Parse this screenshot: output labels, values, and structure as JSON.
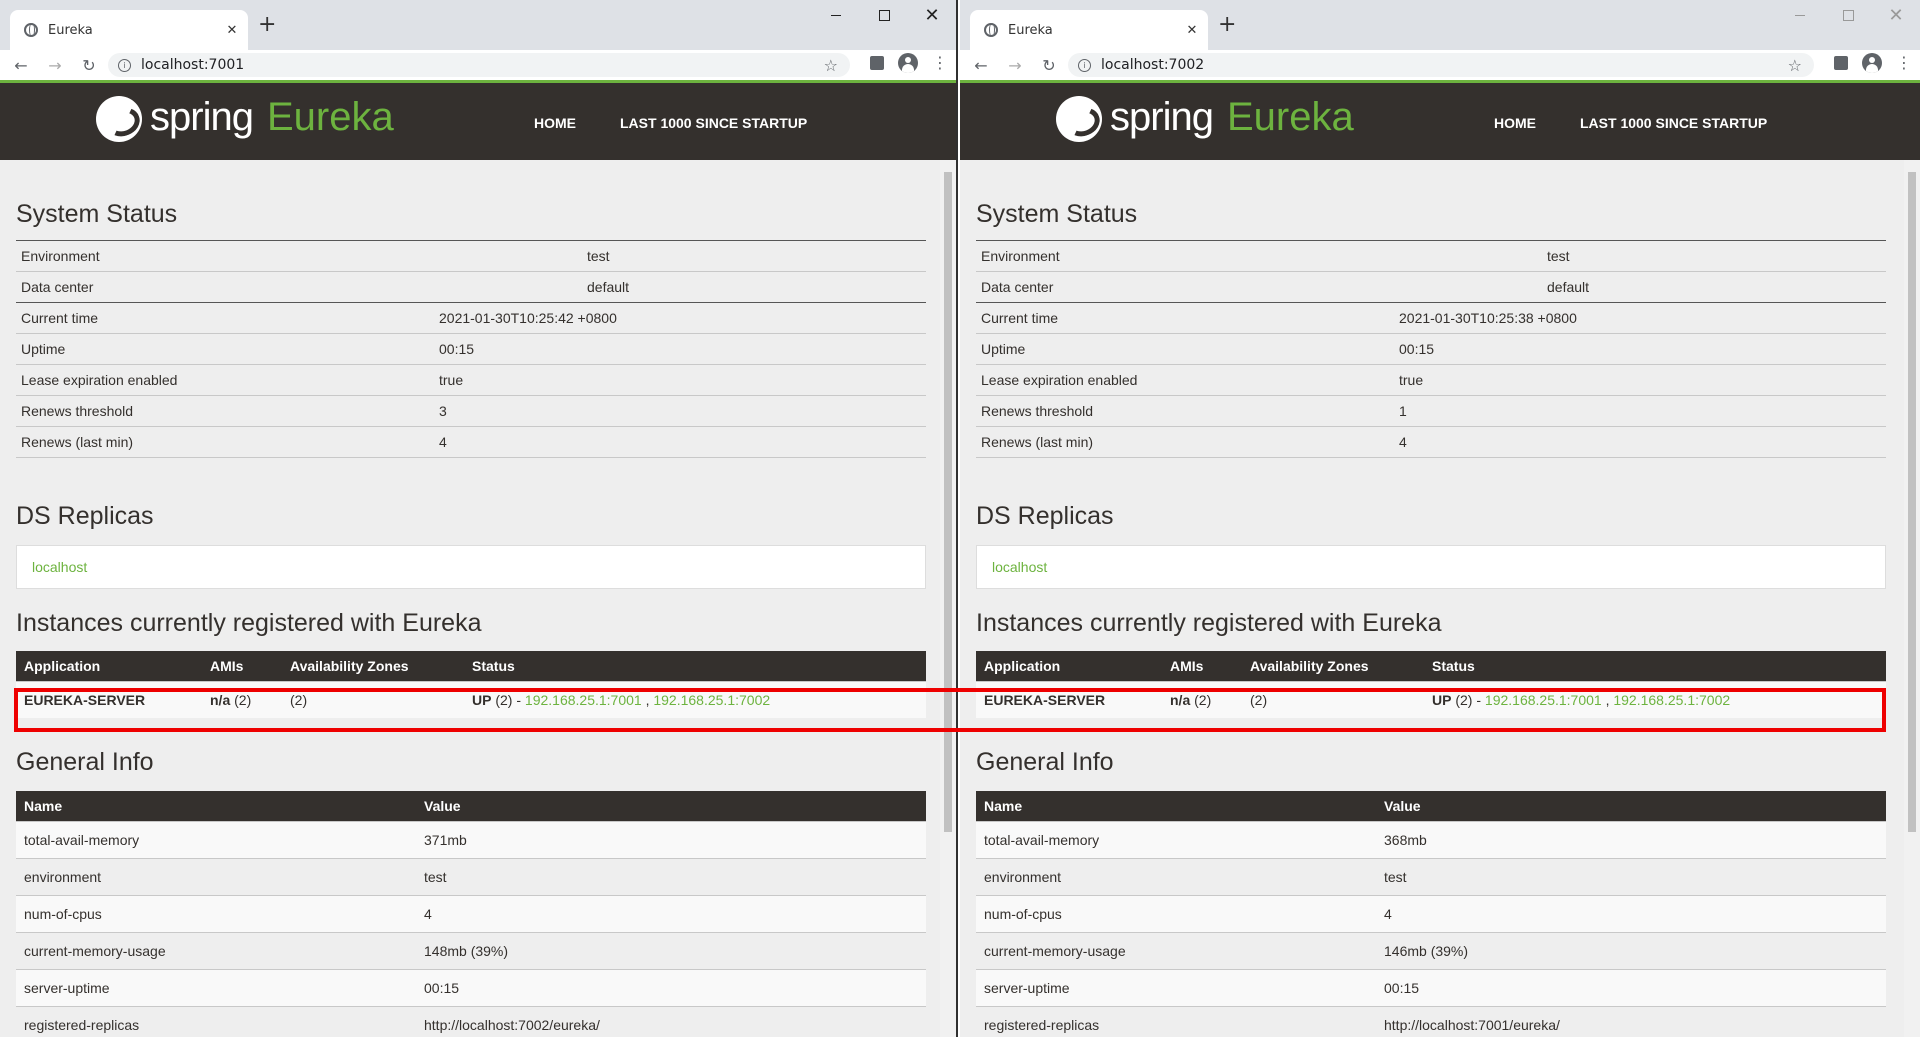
{
  "windows": [
    {
      "id": "left",
      "tab_title": "Eureka",
      "url": "localhost:7001",
      "header": {
        "logo_spring": "spring",
        "logo_eureka": "Eureka",
        "nav_home": "HOME",
        "nav_last": "LAST 1000 SINCE STARTUP"
      },
      "system_status": {
        "title": "System Status",
        "table1": [
          [
            "Environment",
            "test"
          ],
          [
            "Data center",
            "default"
          ]
        ],
        "table2": [
          [
            "Current time",
            "2021-01-30T10:25:42 +0800"
          ],
          [
            "Uptime",
            "00:15"
          ],
          [
            "Lease expiration enabled",
            "true"
          ],
          [
            "Renews threshold",
            "3"
          ],
          [
            "Renews (last min)",
            "4"
          ]
        ]
      },
      "ds_replicas": {
        "title": "DS Replicas",
        "replica": "localhost"
      },
      "instances": {
        "title": "Instances currently registered with Eureka",
        "headers": [
          "Application",
          "AMIs",
          "Availability Zones",
          "Status"
        ],
        "row": {
          "application": "EUREKA-SERVER",
          "amis_bold": "n/a",
          "amis_count": " (2)",
          "zones": "(2)",
          "status_bold": "UP",
          "status_rest": " (2) - ",
          "link1": "192.168.25.1:7001",
          "sep": " , ",
          "link2": "192.168.25.1:7002"
        }
      },
      "general_info": {
        "title": "General Info",
        "headers": [
          "Name",
          "Value"
        ],
        "rows": [
          [
            "total-avail-memory",
            "371mb"
          ],
          [
            "environment",
            "test"
          ],
          [
            "num-of-cpus",
            "4"
          ],
          [
            "current-memory-usage",
            "148mb (39%)"
          ],
          [
            "server-uptime",
            "00:15"
          ],
          [
            "registered-replicas",
            "http://localhost:7002/eureka/"
          ]
        ]
      }
    },
    {
      "id": "right",
      "tab_title": "Eureka",
      "url": "localhost:7002",
      "header": {
        "logo_spring": "spring",
        "logo_eureka": "Eureka",
        "nav_home": "HOME",
        "nav_last": "LAST 1000 SINCE STARTUP"
      },
      "system_status": {
        "title": "System Status",
        "table1": [
          [
            "Environment",
            "test"
          ],
          [
            "Data center",
            "default"
          ]
        ],
        "table2": [
          [
            "Current time",
            "2021-01-30T10:25:38 +0800"
          ],
          [
            "Uptime",
            "00:15"
          ],
          [
            "Lease expiration enabled",
            "true"
          ],
          [
            "Renews threshold",
            "1"
          ],
          [
            "Renews (last min)",
            "4"
          ]
        ]
      },
      "ds_replicas": {
        "title": "DS Replicas",
        "replica": "localhost"
      },
      "instances": {
        "title": "Instances currently registered with Eureka",
        "headers": [
          "Application",
          "AMIs",
          "Availability Zones",
          "Status"
        ],
        "row": {
          "application": "EUREKA-SERVER",
          "amis_bold": "n/a",
          "amis_count": " (2)",
          "zones": "(2)",
          "status_bold": "UP",
          "status_rest": " (2) - ",
          "link1": "192.168.25.1:7001",
          "sep": " , ",
          "link2": "192.168.25.1:7002"
        }
      },
      "general_info": {
        "title": "General Info",
        "headers": [
          "Name",
          "Value"
        ],
        "rows": [
          [
            "total-avail-memory",
            "368mb"
          ],
          [
            "environment",
            "test"
          ],
          [
            "num-of-cpus",
            "4"
          ],
          [
            "current-memory-usage",
            "146mb (39%)"
          ],
          [
            "server-uptime",
            "00:15"
          ],
          [
            "registered-replicas",
            "http://localhost:7001/eureka/"
          ]
        ]
      }
    }
  ],
  "colors": {
    "spring_green": "#6db33f",
    "header_dark": "#34302d",
    "highlight_red": "#ee0000"
  },
  "icons": {
    "back": "arrow-left-icon",
    "forward": "arrow-right-icon",
    "reload": "reload-icon",
    "info": "info-icon",
    "bookmark": "star-icon",
    "extensions": "puzzle-icon",
    "profile": "avatar-icon",
    "menu": "kebab-menu-icon"
  }
}
